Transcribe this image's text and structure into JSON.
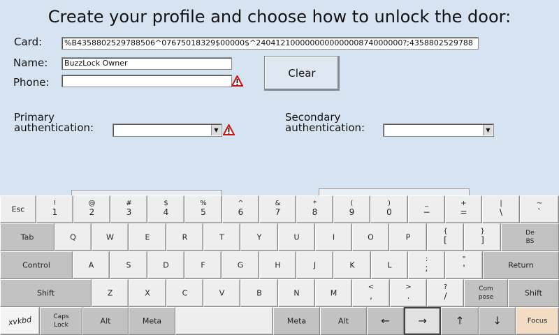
{
  "title": "Create your profile and choose how to unlock the door:",
  "form": {
    "card_label": "Card:",
    "card_value": "%B4358802529788506^07675018329$00000$^240412100000000000000874000000?;4358802529788",
    "name_label": "Name:",
    "name_value": "BuzzLock Owner",
    "phone_label": "Phone:",
    "phone_value": "",
    "clear_label": "Clear",
    "primary_label_1": "Primary",
    "primary_label_2": "authentication:",
    "primary_value": "",
    "secondary_label_1": "Secondary",
    "secondary_label_2": "authentication:",
    "secondary_value": ""
  },
  "colors": {
    "background": "#d6e4f2",
    "warning": "#cc1111",
    "focus_key": "#f2dcc4"
  },
  "keyboard": {
    "esc": "Esc",
    "row1": [
      {
        "s": "!",
        "m": "1"
      },
      {
        "s": "@",
        "m": "2"
      },
      {
        "s": "#",
        "m": "3"
      },
      {
        "s": "$",
        "m": "4"
      },
      {
        "s": "%",
        "m": "5"
      },
      {
        "s": "^",
        "m": "6"
      },
      {
        "s": "&",
        "m": "7"
      },
      {
        "s": "*",
        "m": "8"
      },
      {
        "s": "(",
        "m": "9"
      },
      {
        "s": ")",
        "m": "0"
      },
      {
        "s": "_",
        "m": "−"
      },
      {
        "s": "+",
        "m": "="
      },
      {
        "s": "|",
        "m": "\\"
      },
      {
        "s": "~",
        "m": "`"
      }
    ],
    "tab": "Tab",
    "row2": [
      "Q",
      "W",
      "E",
      "R",
      "T",
      "Y",
      "U",
      "I",
      "O",
      "P"
    ],
    "row2_brace": {
      "s": "{",
      "m": "["
    },
    "row2_bracket": {
      "s": "}",
      "m": "]"
    },
    "del_1": "De",
    "del_2": "BS",
    "control": "Control",
    "row3": [
      "A",
      "S",
      "D",
      "F",
      "G",
      "H",
      "J",
      "K",
      "L"
    ],
    "row3_semi": {
      "s": ":",
      "m": ";"
    },
    "row3_quote": {
      "s": "\"",
      "m": "'"
    },
    "return": "Return",
    "shift": "Shift",
    "row4": [
      "Z",
      "X",
      "C",
      "V",
      "B",
      "N",
      "M"
    ],
    "row4_lt": {
      "s": "<",
      "m": ","
    },
    "row4_gt": {
      "s": ">",
      "m": "."
    },
    "row4_q": {
      "s": "?",
      "m": "/"
    },
    "compose_1": "Com",
    "compose_2": "pose",
    "shift_r": "Shift",
    "logo": "xvkbd",
    "caps_1": "Caps",
    "caps_2": "Lock",
    "alt": "Alt",
    "meta": "Meta",
    "meta_r": "Meta",
    "alt_r": "Alt",
    "left": "←",
    "right": "→",
    "up": "↑",
    "down": "↓",
    "focus": "Focus"
  }
}
